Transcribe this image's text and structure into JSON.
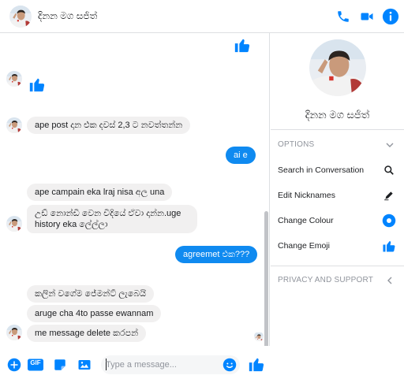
{
  "header": {
    "contact_name": "දිනන මග සජිත්",
    "icons": [
      "phone-icon",
      "video-camera-icon",
      "info-icon"
    ]
  },
  "colors": {
    "accent": "#0084ff",
    "outgoing_bubble": "#0f8af0",
    "incoming_bubble": "#f1f0f0",
    "muted_text": "#90949c"
  },
  "messages": [
    {
      "direction": "out",
      "type": "like"
    },
    {
      "direction": "in",
      "type": "like"
    },
    {
      "direction": "in",
      "text": "ape post දාන එක දවස් 2,3 ට නවත්තන්න"
    },
    {
      "direction": "out",
      "text": "ai e"
    },
    {
      "direction": "in",
      "text": "ape campain eka lraj nisa අල una"
    },
    {
      "direction": "in",
      "text": "උඩ් නොන්ඩි වෙන විදියේ ඒවා දාන්න.uge"
    },
    {
      "direction": "in",
      "text": "history eka ලේල්ලා"
    },
    {
      "direction": "out",
      "text": "agreemet එක???"
    },
    {
      "direction": "in",
      "text": "කලින් වගේම ජේමන්ට් ලැබෙයි"
    },
    {
      "direction": "in",
      "text": "aruge cha 4to passe ewannam"
    },
    {
      "direction": "in",
      "text": "me message delete කරපන්"
    }
  ],
  "composer": {
    "placeholder": "Type a message...",
    "buttons": [
      "add-icon",
      "gif-icon",
      "sticker-icon",
      "photo-icon",
      "emoji-icon",
      "like-icon"
    ],
    "gif_label": "GIF"
  },
  "panel": {
    "name": "දිනන මග සජිත්",
    "options_header": "OPTIONS",
    "items": [
      {
        "label": "Search in Conversation",
        "icon": "search-icon"
      },
      {
        "label": "Edit Nicknames",
        "icon": "pencil-icon"
      },
      {
        "label": "Change Colour",
        "icon": "color-dot-icon"
      },
      {
        "label": "Change Emoji",
        "icon": "thumbs-up-icon"
      }
    ],
    "privacy_header": "PRIVACY AND SUPPORT"
  }
}
